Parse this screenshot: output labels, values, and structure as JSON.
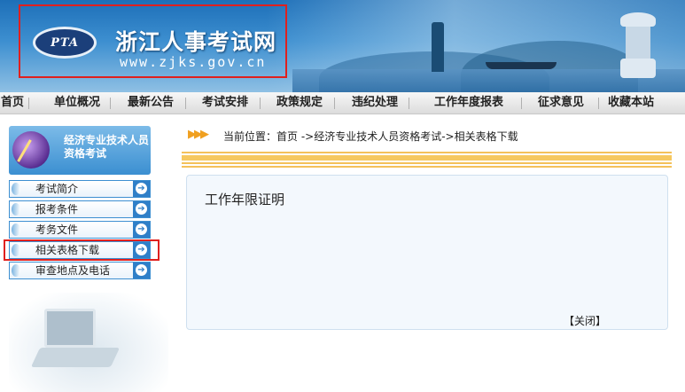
{
  "header": {
    "logo_text": "PTA",
    "site_title": "浙江人事考试网",
    "site_url": "www.zjks.gov.cn"
  },
  "nav": {
    "items": [
      "首页",
      "单位概况",
      "最新公告",
      "考试安排",
      "政策规定",
      "违纪处理",
      "工作年度报表",
      "征求意见",
      "收藏本站"
    ]
  },
  "sidebar": {
    "heading": "经济专业技术人员资格考试",
    "items": [
      {
        "label": "考试简介"
      },
      {
        "label": "报考条件"
      },
      {
        "label": "考务文件"
      },
      {
        "label": "相关表格下载"
      },
      {
        "label": "审查地点及电话"
      }
    ]
  },
  "breadcrumb": {
    "text": "当前位置：首页 ->经济专业技术人员资格考试->相关表格下载"
  },
  "content": {
    "title": "工作年限证明",
    "close_link": "【关闭】"
  },
  "colors": {
    "accent_blue": "#2f7fc8",
    "highlight_red": "#e0201e",
    "stripe_orange": "#f4c15a"
  }
}
